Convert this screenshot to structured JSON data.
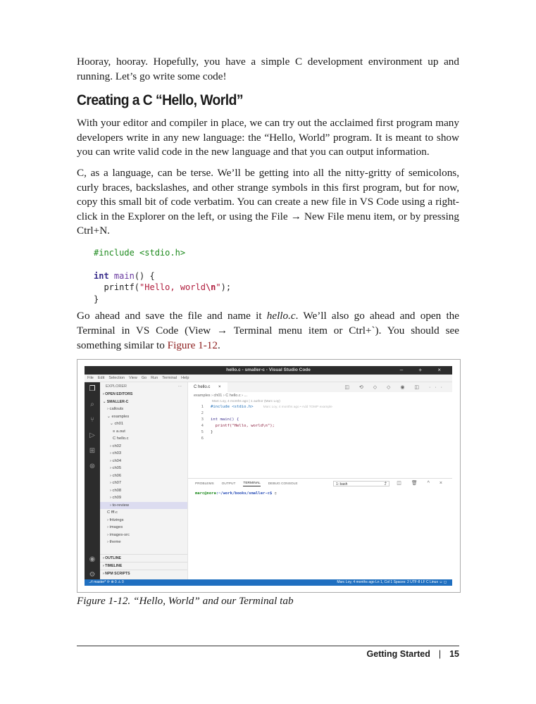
{
  "paragraphs": {
    "intro": "Hooray, hooray. Hopefully, you have a simple C development environment up and running. Let’s go write some code!",
    "p1": "With your editor and compiler in place, we can try out the acclaimed first program many developers write in any new language: the “Hello, World” program. It is meant to show you can write valid code in the new language and that you can output information.",
    "p2": "C, as a language, can be terse. We’ll be getting into all the nitty-gritty of semicolons, curly braces, backslashes, and other strange symbols in this first program, but for now, copy this small bit of code verbatim. You can create a new file in VS Code using a right-click in the Explorer on the left, or using the File → New File menu item, or by pressing Ctrl+N.",
    "p3_a": "Go ahead and save the file and name it ",
    "p3_file": "hello.c",
    "p3_b": ". We’ll also go ahead and open the Terminal in VS Code (View → Terminal menu item or Ctrl+`). You should see something similar to ",
    "p3_ref": "Figure 1-12",
    "p3_c": "."
  },
  "heading": "Creating a C “Hello, World”",
  "code": {
    "include": "#include <stdio.h>",
    "int_kw": "int",
    "main_fn": "main",
    "main_rest": "() {",
    "printf_fn": "printf(",
    "str_a": "\"Hello, world",
    "str_esc": "\\n",
    "str_b": "\"",
    "printf_end": ");",
    "close": "}"
  },
  "screenshot": {
    "window_title": "hello.c - smaller-c - Visual Studio Code",
    "window_controls": "– + ×",
    "menu": [
      "File",
      "Edit",
      "Selection",
      "View",
      "Go",
      "Run",
      "Terminal",
      "Help"
    ],
    "explorer_label": "EXPLORER",
    "explorer_more": "···",
    "tree": [
      {
        "label": "› OPEN EDITORS",
        "indent": 4,
        "bold": true,
        "sel": false
      },
      {
        "label": "⌄ SMALLER-C",
        "indent": 4,
        "bold": true,
        "sel": false
      },
      {
        "label": "› callouts",
        "indent": 10,
        "bold": false,
        "sel": false
      },
      {
        "label": "⌄ examples",
        "indent": 10,
        "bold": false,
        "sel": false
      },
      {
        "label": "⌄ ch01",
        "indent": 14,
        "bold": false,
        "sel": false
      },
      {
        "label": "≡ a.out",
        "indent": 18,
        "bold": false,
        "sel": false
      },
      {
        "label": "C hello.c",
        "indent": 18,
        "bold": false,
        "sel": false
      },
      {
        "label": "› ch02",
        "indent": 14,
        "bold": false,
        "sel": false
      },
      {
        "label": "› ch03",
        "indent": 14,
        "bold": false,
        "sel": false
      },
      {
        "label": "› ch04",
        "indent": 14,
        "bold": false,
        "sel": false
      },
      {
        "label": "› ch05",
        "indent": 14,
        "bold": false,
        "sel": false
      },
      {
        "label": "› ch06",
        "indent": 14,
        "bold": false,
        "sel": false
      },
      {
        "label": "› ch07",
        "indent": 14,
        "bold": false,
        "sel": false
      },
      {
        "label": "› ch08",
        "indent": 14,
        "bold": false,
        "sel": false
      },
      {
        "label": "› ch09",
        "indent": 14,
        "bold": false,
        "sel": false
      },
      {
        "label": "› to-review",
        "indent": 14,
        "bold": false,
        "sel": true
      },
      {
        "label": "C fff.c",
        "indent": 10,
        "bold": false,
        "sel": false
      },
      {
        "label": "› fritzings",
        "indent": 10,
        "bold": false,
        "sel": false
      },
      {
        "label": "› images",
        "indent": 10,
        "bold": false,
        "sel": false
      },
      {
        "label": "› images-src",
        "indent": 10,
        "bold": false,
        "sel": false
      },
      {
        "label": "› theme",
        "indent": 10,
        "bold": false,
        "sel": false
      }
    ],
    "outline": "› OUTLINE",
    "timeline": "› TIMELINE",
    "npm": "› NPM SCRIPTS",
    "tab_label": "C  hello.c",
    "tab_close": "×",
    "editor_tools": "◫ ⟲ ◇ ◇ ◉ ◫ ···",
    "breadcrumb": "examples › ch01 › C hello.c › ...",
    "blame": "Marc Loy, 4 months ago | 1 author (Marc Loy)",
    "lines": [
      {
        "n": "1",
        "text": "#include <stdio.h>",
        "ghost": "Marc Loy, 4 months ago • Add TOMP example"
      },
      {
        "n": "2",
        "text": "",
        "ghost": ""
      },
      {
        "n": "3",
        "text": "int main() {",
        "ghost": ""
      },
      {
        "n": "4",
        "text": "  printf(\"Hello, world\\n\");",
        "ghost": ""
      },
      {
        "n": "5",
        "text": "}",
        "ghost": ""
      },
      {
        "n": "6",
        "text": "",
        "ghost": ""
      }
    ],
    "panel_tabs": [
      "PROBLEMS",
      "OUTPUT",
      "TERMINAL",
      "DEBUG CONSOLE"
    ],
    "panel_active": "TERMINAL",
    "shell": "1: bash",
    "panel_tools": "+ ◫ 🗑 ^ ×",
    "prompt_user": "marc@nora",
    "prompt_path": ":~/work/books/smaller-c$",
    "cursor": " ▯",
    "status_left": "⎇ master*  ⟳  ⊗ 0 ⚠ 0",
    "status_right": "Marc Loy, 4 months ago   Ln 1, Col 1   Spaces: 2   UTF-8   LF   C   Linux   ☺ ◻"
  },
  "caption": "Figure 1-12. “Hello, World” and our Terminal tab",
  "footer": {
    "section": "Getting Started",
    "separator": "|",
    "page": "15"
  }
}
